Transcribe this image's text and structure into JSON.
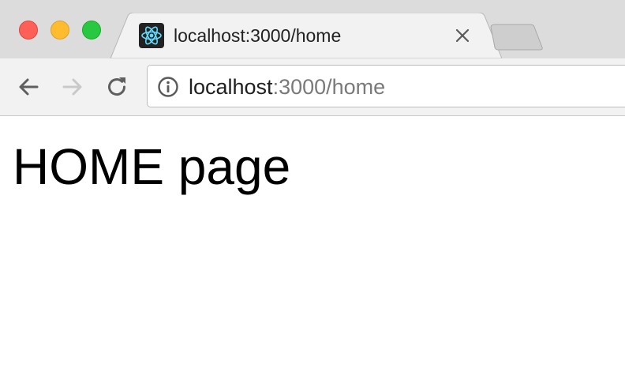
{
  "colors": {
    "close": "#fe5f57",
    "minimize": "#febc2e",
    "maximize": "#28c840",
    "tabstrip_bg": "#dcdcdc",
    "toolbar_bg": "#f2f2f2",
    "favicon_accent": "#61dafb"
  },
  "tab": {
    "title": "localhost:3000/home",
    "favicon": "react-atom-icon"
  },
  "toolbar": {
    "icons": [
      "back-arrow-icon",
      "forward-arrow-icon",
      "reload-icon"
    ],
    "address": {
      "security_icon": "info-icon",
      "host": "localhost",
      "rest": ":3000/home"
    }
  },
  "page": {
    "heading": "HOME page"
  }
}
